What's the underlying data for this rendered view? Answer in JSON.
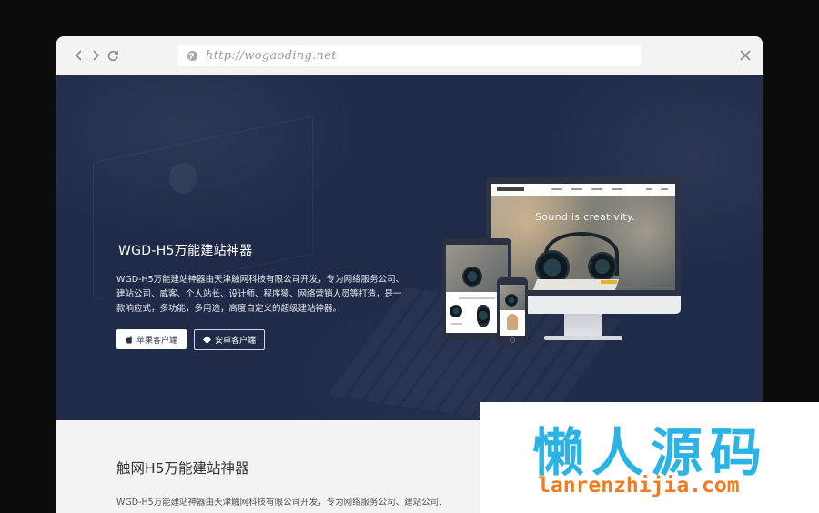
{
  "browser": {
    "address_url": "http://wogaoding.net",
    "nav_icons": [
      "back-icon",
      "forward-icon",
      "reload-icon"
    ],
    "close_icon": "close-icon"
  },
  "hero": {
    "title": "WGD-H5万能建站神器",
    "description": "WGD-H5万能建站神器由天津触网科技有限公司开发，专为网络服务公司、建站公司、威客、个人站长、设计师、程序猿、网络营销人员等打造，是一款响应式，多功能，多用途，高度自定义的超级建站神器。",
    "btn_apple": "苹果客户端",
    "btn_android": "安卓客户端",
    "bg_color": "#1f2b48"
  },
  "mockup": {
    "site_tagline": "Sound is creativity."
  },
  "section": {
    "title": "触网H5万能建站神器",
    "description": "WGD-H5万能建站神器由天津触网科技有限公司开发，专为网络服务公司、建站公司、"
  },
  "watermark": {
    "title": "懒人源码",
    "url": "lanrenzhijia.com",
    "title_color": "#2bb3e6",
    "url_color": "#ef7c22"
  }
}
